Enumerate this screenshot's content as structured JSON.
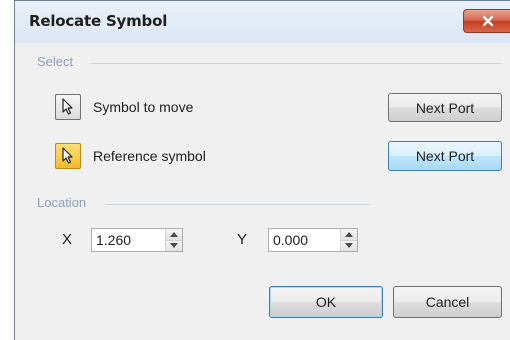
{
  "window": {
    "title": "Relocate Symbol",
    "close_icon": "close-icon"
  },
  "select_group": {
    "label": "Select",
    "symbol_to_move": {
      "label": "Symbol to move",
      "tool_icon": "pointer-arrow-icon",
      "next_port_label": "Next Port"
    },
    "reference_symbol": {
      "label": "Reference symbol",
      "tool_icon": "pointer-arrow-icon",
      "next_port_label": "Next Port"
    }
  },
  "location_group": {
    "label": "Location",
    "x": {
      "label": "X",
      "value": "1.260"
    },
    "y": {
      "label": "Y",
      "value": "0.000"
    }
  },
  "footer": {
    "ok_label": "OK",
    "cancel_label": "Cancel"
  },
  "colors": {
    "close_button": "#c94a31",
    "active_tool": "#f7c53d",
    "group_label": "#8ea2bd",
    "hot_button": "#bee6fd"
  }
}
